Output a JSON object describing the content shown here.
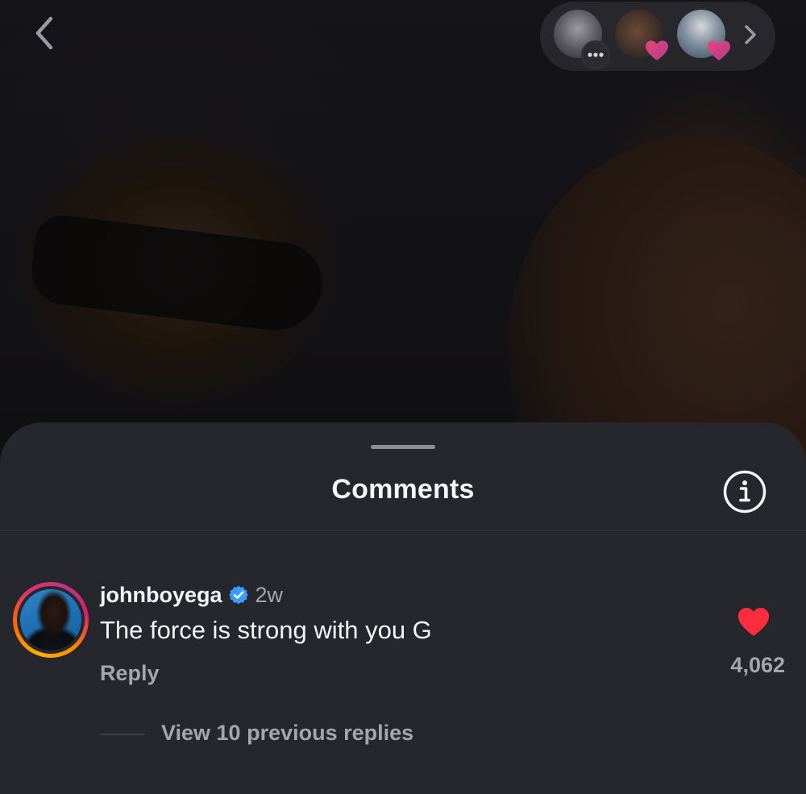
{
  "top_bar": {
    "back_icon": "chevron-left-icon",
    "story_tray": {
      "avatars": [
        {
          "badge_icon": "chat-bubble-icon"
        },
        {
          "badge_icon": "heart-icon"
        },
        {
          "badge_icon": "heart-icon"
        }
      ],
      "next_icon": "chevron-right-icon"
    }
  },
  "comments_sheet": {
    "title": "Comments",
    "info_icon": "info-icon",
    "comment": {
      "username": "johnboyega",
      "verified": true,
      "timestamp": "2w",
      "text": "The force is strong with you G",
      "reply_label": "Reply",
      "like_count": "4,062",
      "liked": true
    },
    "view_replies_label": "View 10 previous replies"
  },
  "colors": {
    "sheet_bg": "#25272d",
    "text_primary": "#f5f5f7",
    "text_secondary": "#a4a6ad",
    "like_red": "#ff2d3b",
    "verified_blue": "#3b9bff"
  }
}
